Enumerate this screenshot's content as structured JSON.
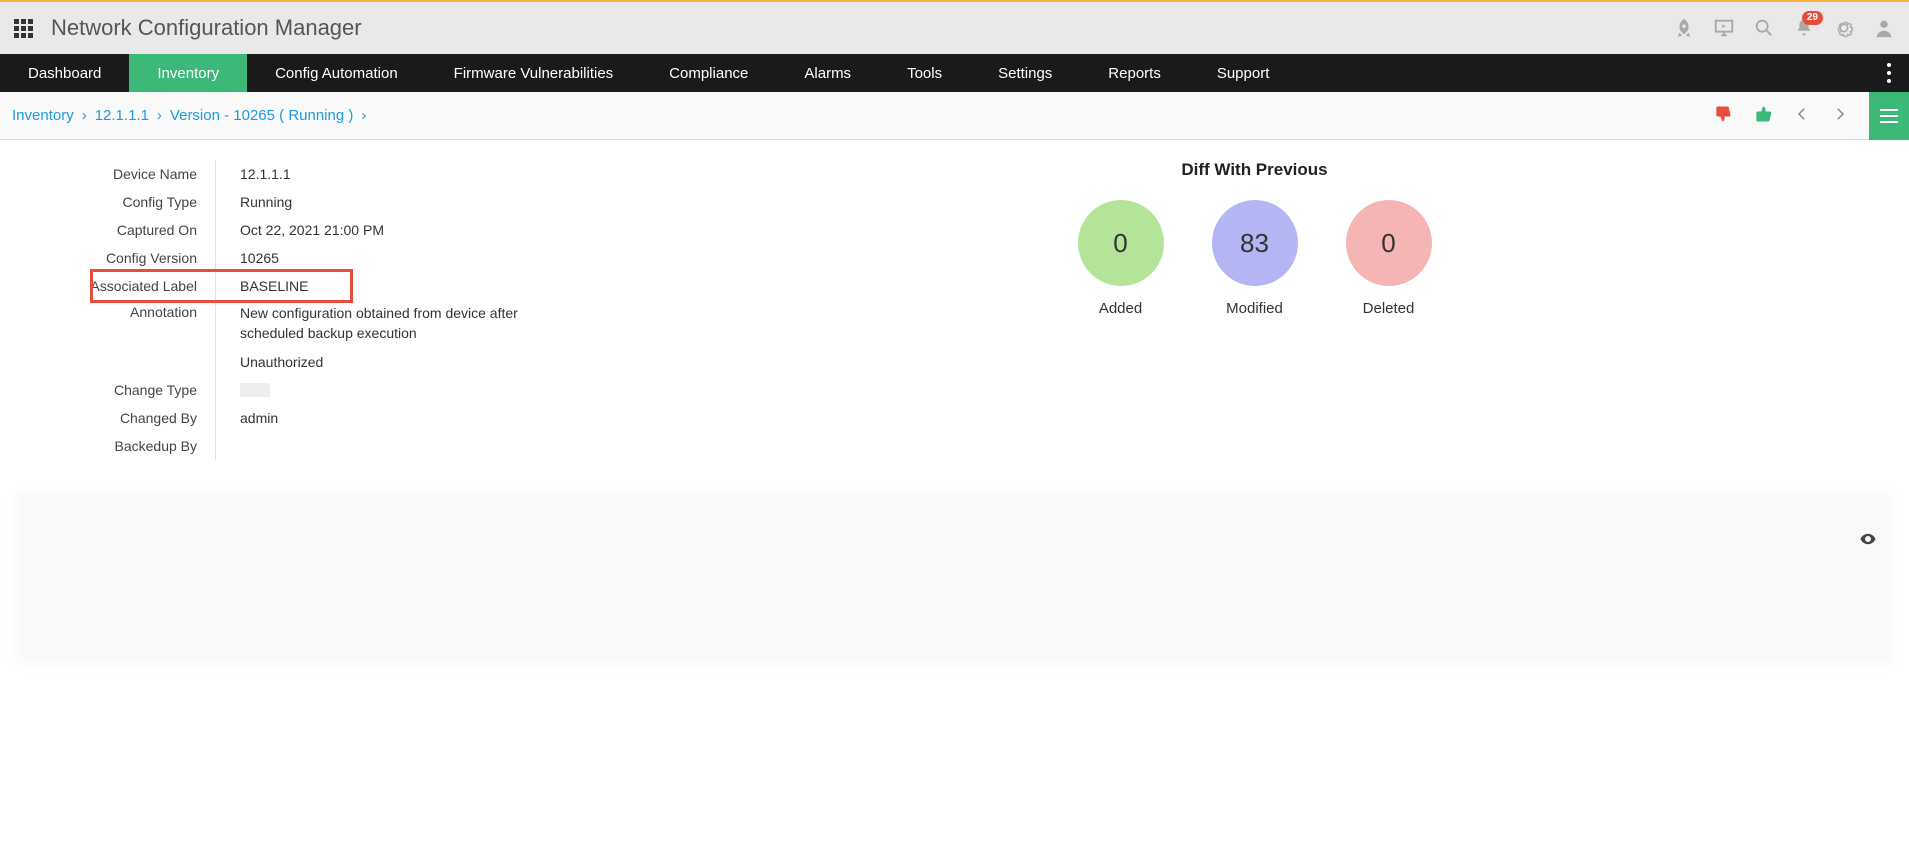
{
  "header": {
    "app_title": "Network Configuration Manager",
    "notification_count": "29"
  },
  "nav": {
    "items": [
      "Dashboard",
      "Inventory",
      "Config Automation",
      "Firmware Vulnerabilities",
      "Compliance",
      "Alarms",
      "Tools",
      "Settings",
      "Reports",
      "Support"
    ],
    "active_index": 1
  },
  "breadcrumb": {
    "items": [
      "Inventory",
      "12.1.1.1",
      "Version - 10265 ( Running )"
    ]
  },
  "details": {
    "labels": {
      "device_name": "Device Name",
      "config_type": "Config Type",
      "captured_on": "Captured On",
      "config_version": "Config Version",
      "associated_label": "Associated Label",
      "annotation": "Annotation",
      "change_type": "Change Type",
      "changed_by": "Changed By",
      "backedup_by": "Backedup By"
    },
    "values": {
      "device_name": "12.1.1.1",
      "config_type": "Running",
      "captured_on": "Oct 22, 2021 21:00 PM",
      "config_version": "10265",
      "associated_label": "BASELINE",
      "annotation": "New configuration obtained from device after scheduled backup execution",
      "change_type": "Unauthorized",
      "changed_by": "",
      "backedup_by": "admin"
    }
  },
  "diff": {
    "title": "Diff With Previous",
    "added": {
      "value": "0",
      "label": "Added"
    },
    "modified": {
      "value": "83",
      "label": "Modified"
    },
    "deleted": {
      "value": "0",
      "label": "Deleted"
    }
  }
}
